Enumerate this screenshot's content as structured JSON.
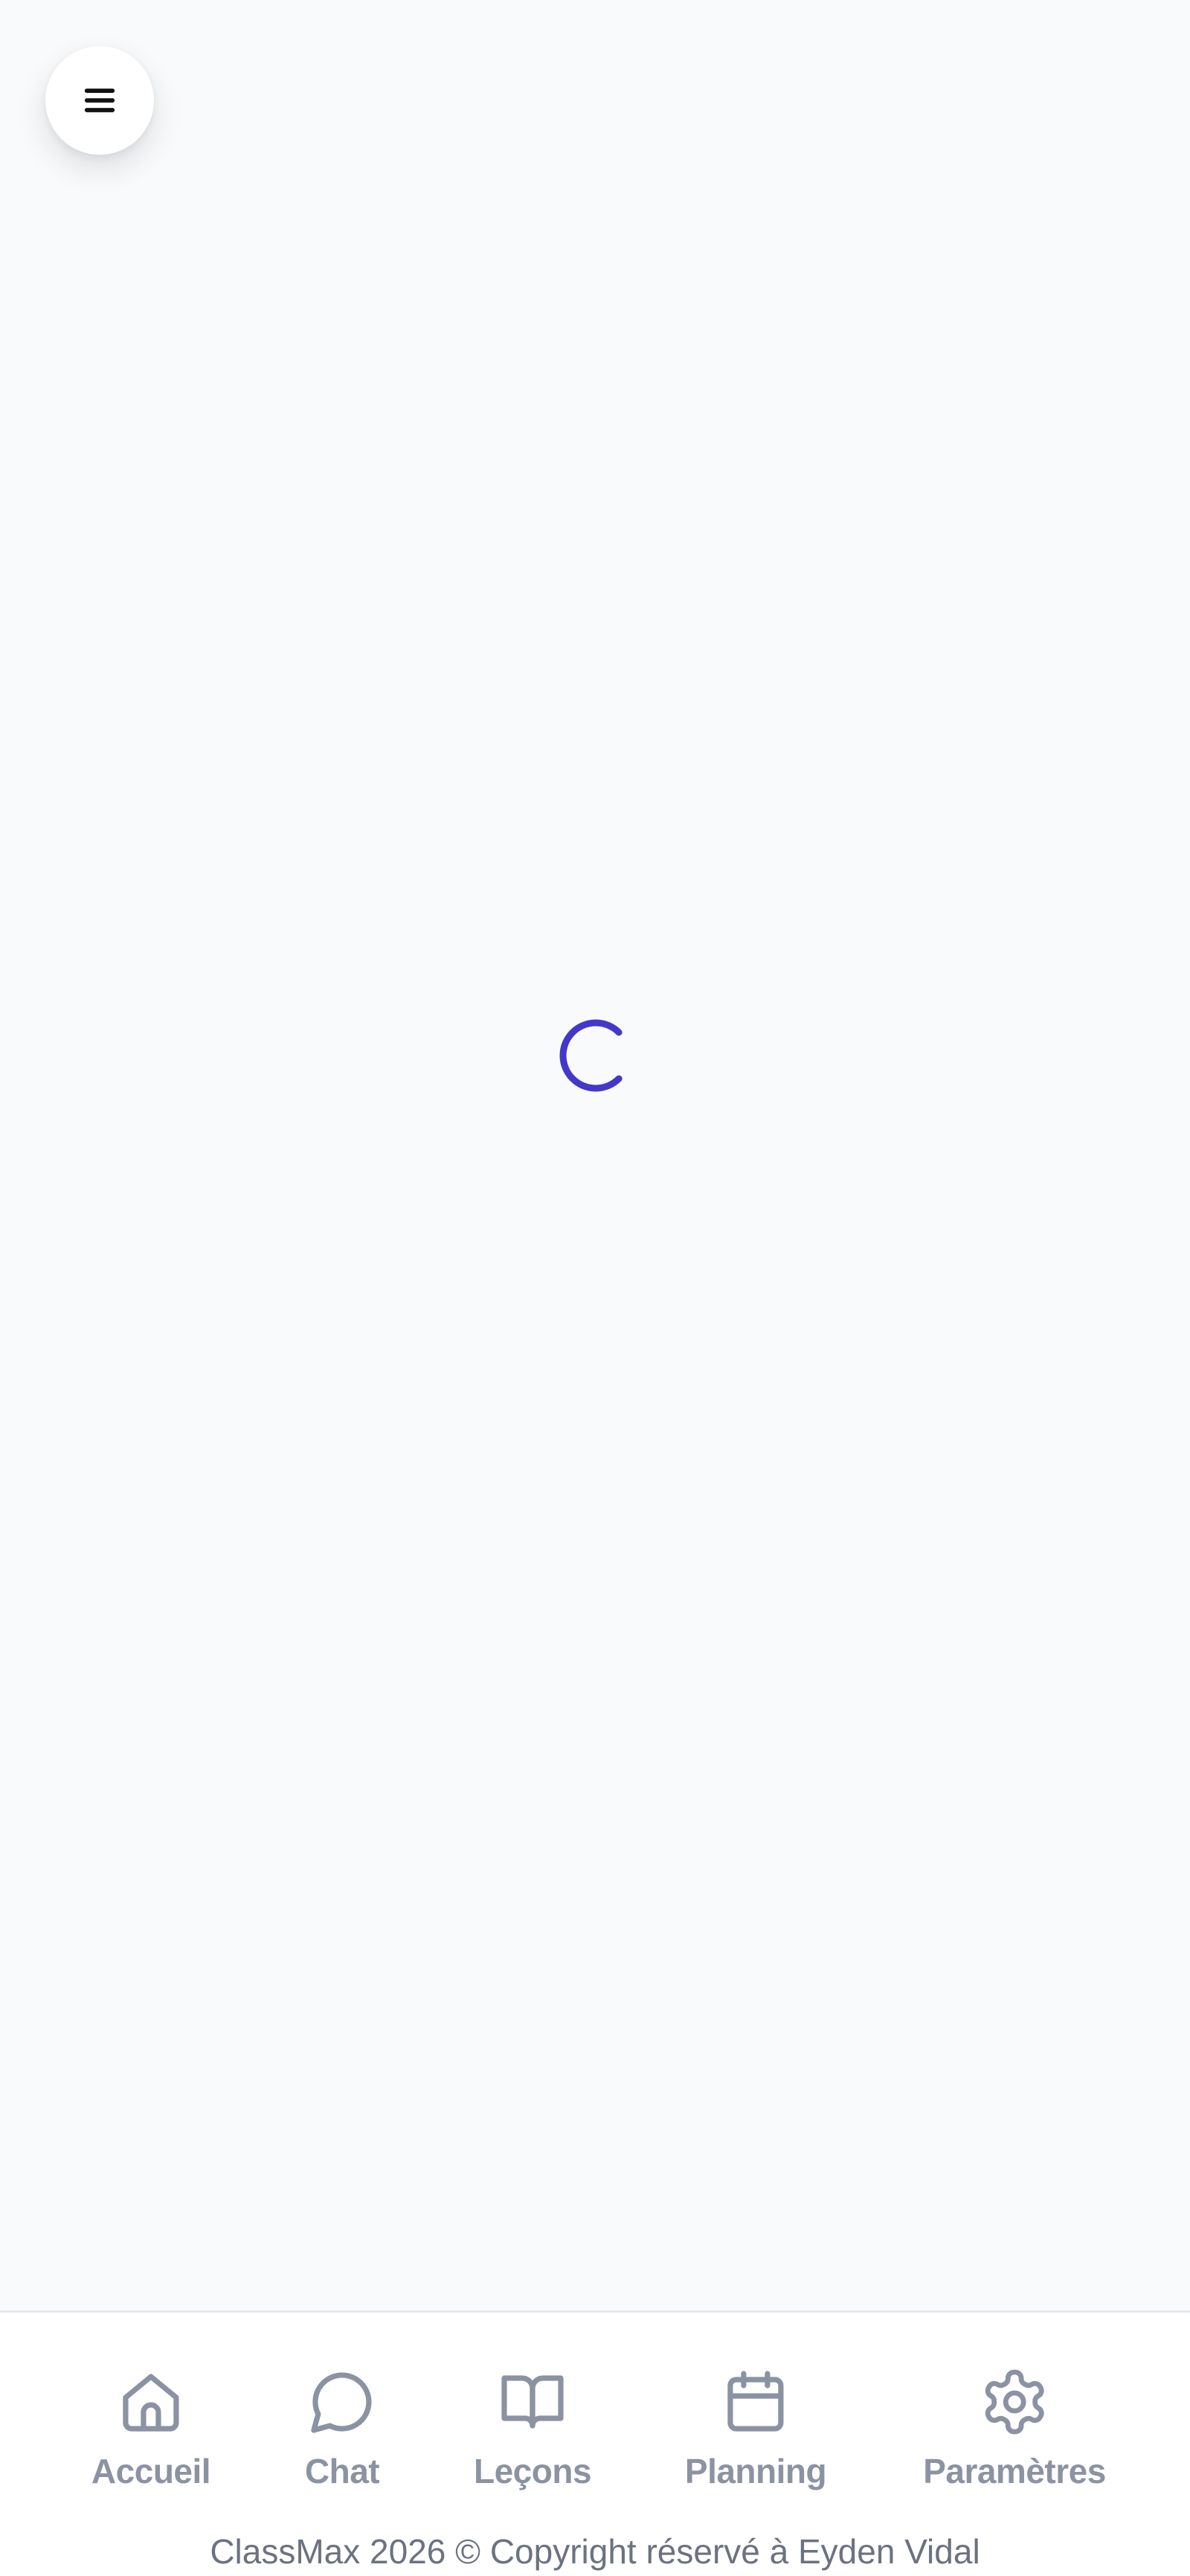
{
  "colors": {
    "background": "#f9fafb",
    "spinner": "#4338ca",
    "nav_icon": "#8b93a3",
    "nav_label": "#8b93a3",
    "footer_text": "#6b7280"
  },
  "header": {
    "menu_icon": "hamburger-icon"
  },
  "main": {
    "loading_indicator": "spinner-icon"
  },
  "bottom_nav": {
    "items": [
      {
        "label": "Accueil",
        "icon": "home-icon"
      },
      {
        "label": "Chat",
        "icon": "chat-bubble-icon"
      },
      {
        "label": "Leçons",
        "icon": "book-open-icon"
      },
      {
        "label": "Planning",
        "icon": "calendar-icon"
      },
      {
        "label": "Paramètres",
        "icon": "gear-icon"
      }
    ]
  },
  "footer": {
    "copyright": "ClassMax 2026 © Copyright réservé à Eyden Vidal"
  }
}
